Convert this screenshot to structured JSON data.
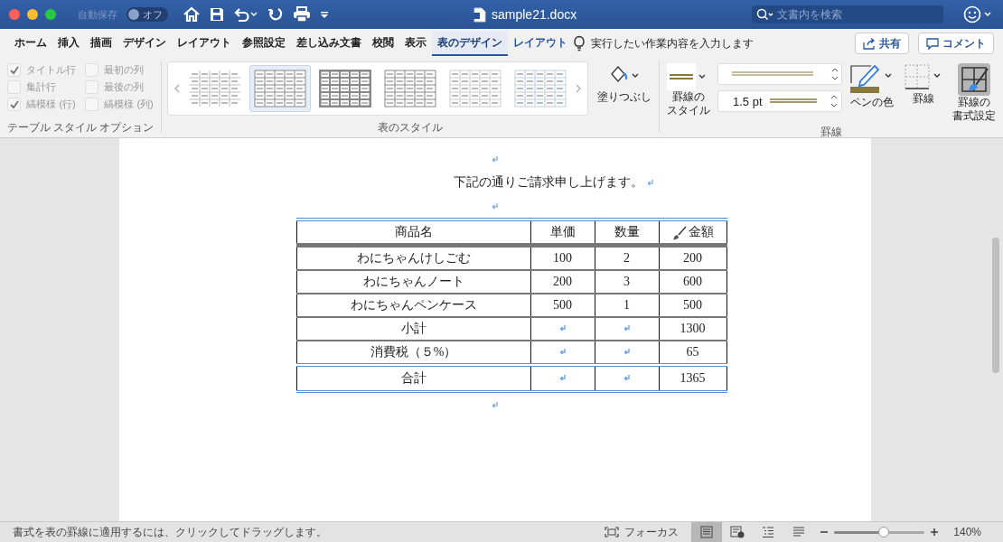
{
  "window": {
    "title": "sample21.docx",
    "autosave_label": "自動保存",
    "autosave_state": "オフ",
    "autosave_on": false,
    "search": {
      "placeholder": "文書内を検索"
    }
  },
  "tabs": [
    {
      "label": "ホーム",
      "selected": false
    },
    {
      "label": "挿入",
      "selected": false
    },
    {
      "label": "描画",
      "selected": false
    },
    {
      "label": "デザイン",
      "selected": false
    },
    {
      "label": "レイアウト",
      "selected": false
    },
    {
      "label": "参照設定",
      "selected": false
    },
    {
      "label": "差し込み文書",
      "selected": false
    },
    {
      "label": "校閲",
      "selected": false
    },
    {
      "label": "表示",
      "selected": false
    },
    {
      "label": "表のデザイン",
      "selected": true,
      "contextual": true
    },
    {
      "label": "レイアウト",
      "selected": false,
      "contextual": true
    }
  ],
  "tell_me": "実行したい作業内容を入力します",
  "share_button": "共有",
  "comment_button": "コメント",
  "ribbon": {
    "style_options": {
      "title": "テーブル スタイル オプション",
      "options": [
        {
          "label": "タイトル行",
          "checked": true
        },
        {
          "label": "最初の列",
          "checked": false
        },
        {
          "label": "集計行",
          "checked": false
        },
        {
          "label": "最後の列",
          "checked": false
        },
        {
          "label": "縞模様 (行)",
          "checked": true
        },
        {
          "label": "縞模様 (列)",
          "checked": false
        }
      ]
    },
    "table_styles": {
      "title": "表のスタイル",
      "styles": [
        {
          "kind": "plain",
          "selected": false
        },
        {
          "kind": "grid",
          "selected": true
        },
        {
          "kind": "dark",
          "selected": false
        },
        {
          "kind": "grid",
          "selected": false
        },
        {
          "kind": "light",
          "selected": false
        },
        {
          "kind": "blue",
          "selected": false
        }
      ],
      "shading_label": "塗りつぶし"
    },
    "borders": {
      "title": "罫線",
      "style_label": [
        "罫線の",
        "スタイル"
      ],
      "weight": "1.5 pt",
      "pen_color_label": "ペンの色",
      "borders_label": "罫線",
      "painter_label": [
        "罫線の",
        "書式設定"
      ]
    }
  },
  "document": {
    "intro": "下記の通りご請求申し上げます。",
    "table": {
      "columns": [
        "商品名",
        "単価",
        "数量",
        "金額"
      ],
      "rows": [
        [
          "わにちゃんけしごむ",
          "100",
          "2",
          "200"
        ],
        [
          "わにちゃんノート",
          "200",
          "3",
          "600"
        ],
        [
          "わにちゃんペンケース",
          "500",
          "1",
          "500"
        ],
        [
          "小計",
          "",
          "",
          "1300"
        ],
        [
          "消費税（５%）",
          "",
          "",
          "65"
        ],
        [
          "合計",
          "",
          "",
          "1365"
        ]
      ]
    }
  },
  "status_bar": {
    "message": "書式を表の罫線に適用するには、クリックしてドラッグします。",
    "focus": "フォーカス",
    "views": [
      {
        "kind": "print",
        "selected": true
      },
      {
        "kind": "web",
        "selected": false
      },
      {
        "kind": "outline",
        "selected": false
      },
      {
        "kind": "draft",
        "selected": false
      }
    ],
    "zoom": {
      "level": 0.55,
      "reading": "140%"
    }
  }
}
